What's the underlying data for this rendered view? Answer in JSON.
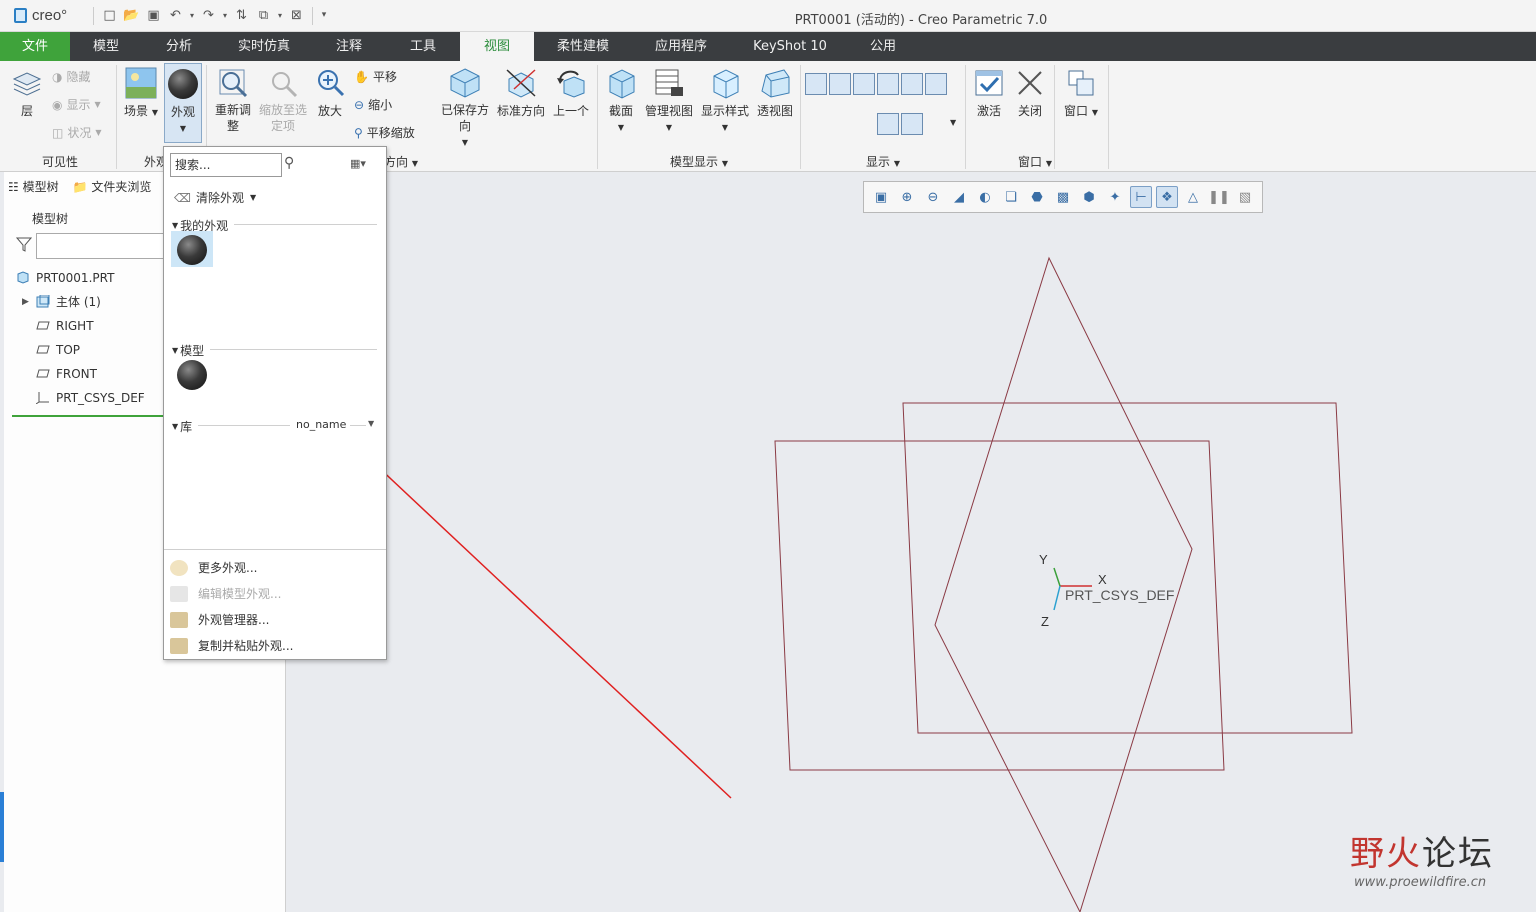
{
  "app": {
    "logo_text": "creo°",
    "window_title": "PRT0001 (活动的) - Creo Parametric 7.0"
  },
  "menu_tabs": [
    "文件",
    "模型",
    "分析",
    "实时仿真",
    "注释",
    "工具",
    "视图",
    "柔性建模",
    "应用程序",
    "KeyShot 10",
    "公用"
  ],
  "active_tab": "视图",
  "ribbon": {
    "visibility": {
      "layer": "层",
      "hide": "隐藏",
      "show": "显示",
      "status": "状况",
      "label": "可见性"
    },
    "appearance": {
      "scene": "场景",
      "appearance": "外观",
      "label": "外观"
    },
    "orientation": {
      "refit": "重新调整",
      "zoom_to_selected": "缩放至选定项",
      "zoom_in": "放大",
      "pan": "平移",
      "zoom_out": "缩小",
      "pan_zoom": "平移缩放",
      "saved_orientations": "已保存方向",
      "standard_orientation": "标准方向",
      "previous": "上一个",
      "label": "方向"
    },
    "model_display": {
      "section": "截面",
      "manage_views": "管理视图",
      "display_style": "显示样式",
      "perspective": "透视图",
      "label": "模型显示"
    },
    "show": {
      "label": "显示"
    },
    "window": {
      "activate": "激活",
      "close": "关闭",
      "windows": "窗口",
      "label": "窗口"
    }
  },
  "left_panel": {
    "tabs": [
      "模型树",
      "文件夹浏览"
    ],
    "title": "模型树",
    "tree": [
      {
        "label": "PRT0001.PRT",
        "icon": "part-icon"
      },
      {
        "label": "主体 (1)",
        "icon": "body-icon"
      },
      {
        "label": "RIGHT",
        "icon": "datum-plane-icon"
      },
      {
        "label": "TOP",
        "icon": "datum-plane-icon"
      },
      {
        "label": "FRONT",
        "icon": "datum-plane-icon"
      },
      {
        "label": "PRT_CSYS_DEF",
        "icon": "csys-icon"
      }
    ]
  },
  "appearance_dropdown": {
    "search_placeholder": "搜索...",
    "clear_appearance": "清除外观",
    "my_appearances": "我的外观",
    "model": "模型",
    "library": "库",
    "library_name": "no_name",
    "footer_items": [
      {
        "label": "更多外观...",
        "enabled": true
      },
      {
        "label": "编辑模型外观...",
        "enabled": false
      },
      {
        "label": "外观管理器...",
        "enabled": true
      },
      {
        "label": "复制并粘贴外观...",
        "enabled": true
      }
    ]
  },
  "viewport": {
    "csys_label": "PRT_CSYS_DEF",
    "axis_x": "X",
    "axis_y": "Y",
    "axis_z": "Z",
    "datum_color": "#8a3a44",
    "annotation_arrow_color": "#e02020"
  },
  "watermark": {
    "text_red": "野火",
    "text_dark": "论坛",
    "url": "www.proewildfire.cn"
  }
}
